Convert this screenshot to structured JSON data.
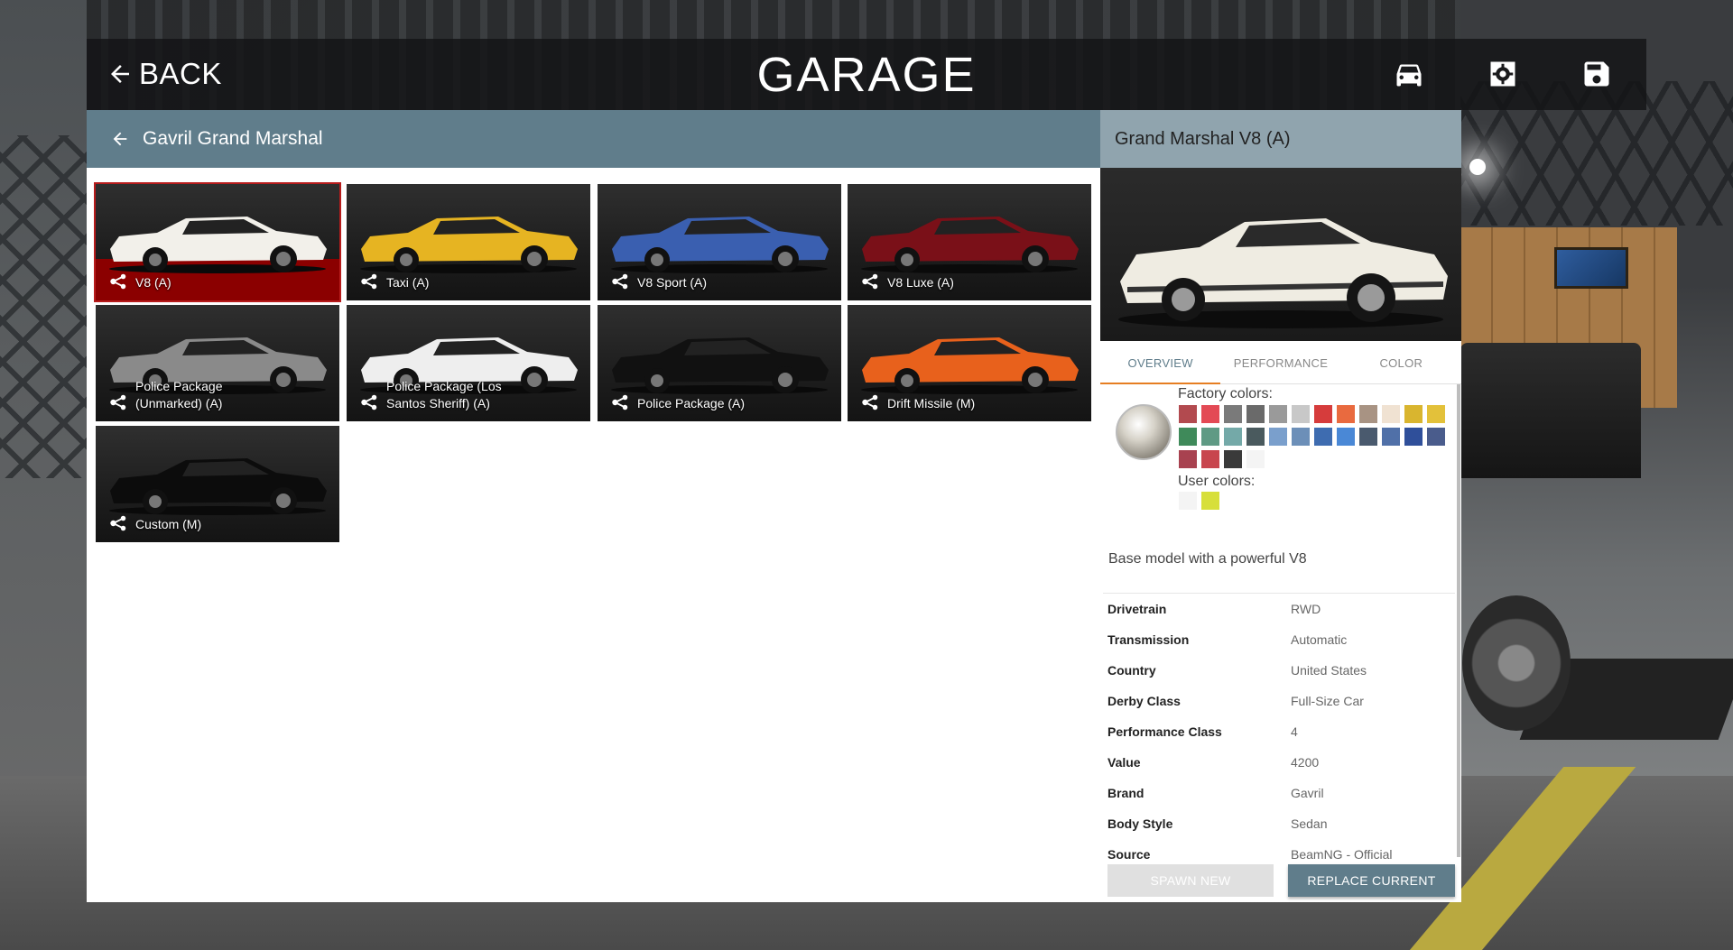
{
  "header": {
    "back_label": "BACK",
    "title": "GARAGE",
    "icons": [
      "car-icon",
      "gear-icon",
      "save-icon"
    ]
  },
  "list": {
    "breadcrumb": "Gavril Grand Marshal",
    "configs": [
      {
        "label": "V8 (A)",
        "color": "#f2f0ea",
        "selected": true
      },
      {
        "label": "Taxi (A)",
        "color": "#e6b422"
      },
      {
        "label": "V8 Sport (A)",
        "color": "#3a5fb0"
      },
      {
        "label": "V8 Luxe (A)",
        "color": "#7a1018"
      },
      {
        "label": "Police Package (Unmarked) (A)",
        "color": "#8a8a8a"
      },
      {
        "label": "Police Package (Los Santos Sheriff) (A)",
        "color": "#eeeeee"
      },
      {
        "label": "Police Package (A)",
        "color": "#111111"
      },
      {
        "label": "Drift Missile (M)",
        "color": "#e8611c"
      },
      {
        "label": "Custom (M)",
        "color": "#0c0c0c"
      }
    ]
  },
  "detail": {
    "title": "Grand Marshal V8 (A)",
    "tabs": [
      "OVERVIEW",
      "PERFORMANCE",
      "COLOR"
    ],
    "active_tab": "OVERVIEW",
    "factory_colors_label": "Factory colors:",
    "user_colors_label": "User colors:",
    "factory_colors": [
      "#b24a4f",
      "#e34a55",
      "#7a7a7a",
      "#6a6a6a",
      "#9a9a9a",
      "#c8c8c8",
      "#d63c3c",
      "#e96a3f",
      "#a89383",
      "#f0e2d2",
      "#d9b52f",
      "#e3c13a",
      "#3f8a5a",
      "#5f9a84",
      "#74a9a8",
      "#4a5a5e",
      "#7a9fcc",
      "#6c8fb8",
      "#3e6cb0",
      "#4a88d6",
      "#4a5a6e",
      "#5070a8",
      "#2f4f9a",
      "#4a5c8c",
      "#a84250",
      "#c8464e",
      "#3a3a3a",
      "#f4f4f4"
    ],
    "user_colors": [
      "#f4f4f4",
      "#d7df3a"
    ],
    "description": "Base model with a powerful V8",
    "specs": [
      {
        "key": "Drivetrain",
        "value": "RWD"
      },
      {
        "key": "Transmission",
        "value": "Automatic"
      },
      {
        "key": "Country",
        "value": "United States"
      },
      {
        "key": "Derby Class",
        "value": "Full-Size Car"
      },
      {
        "key": "Performance Class",
        "value": "4"
      },
      {
        "key": "Value",
        "value": "4200"
      },
      {
        "key": "Brand",
        "value": "Gavril"
      },
      {
        "key": "Body Style",
        "value": "Sedan"
      },
      {
        "key": "Source",
        "value": "BeamNG - Official"
      }
    ],
    "spawn_label": "SPAWN NEW",
    "replace_label": "REPLACE CURRENT"
  },
  "colors": {
    "header_bar": "#607d8b",
    "detail_bar": "#90a4ae",
    "selected_tile": "#8b0000",
    "accent": "#e67e22"
  }
}
